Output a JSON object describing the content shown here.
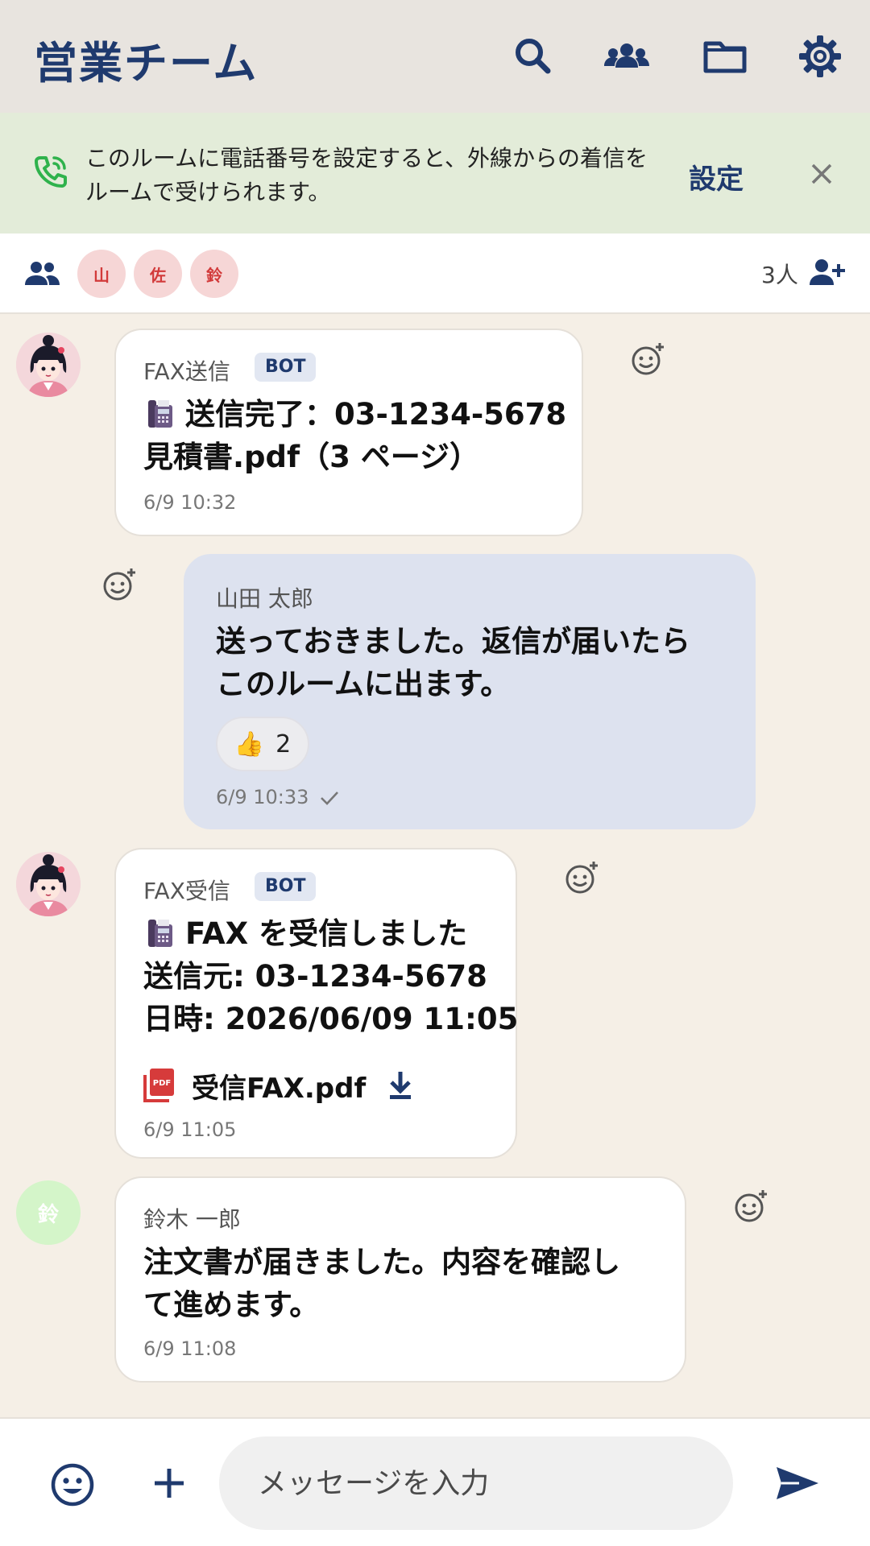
{
  "header": {
    "title": "営業チーム",
    "icons": [
      "search-icon",
      "members-icon",
      "folder-icon",
      "gear-icon"
    ]
  },
  "banner": {
    "text": "このルームに電話番号を設定すると、外線からの着信をルームで受けられます。",
    "setting_label": "設定"
  },
  "members": {
    "avatars": [
      "山",
      "佐",
      "鈴"
    ],
    "count": "3人"
  },
  "messages": [
    {
      "sender": "FAX送信",
      "badge": "BOT",
      "line1": "送信完了：03-1234-5678",
      "line2": "見積書.pdf（3 ページ）",
      "time": "6/9 10:32"
    },
    {
      "sender": "山田 太郎",
      "line1": "送っておきました。返信が届いたら",
      "line2": "このルームに出ます。",
      "reaction_emoji": "👍",
      "reaction_count": "2",
      "time": "6/9 10:33"
    },
    {
      "sender": "FAX受信",
      "badge": "BOT",
      "line1": "FAX を受信しました",
      "line2": "送信元: 03-1234-5678",
      "line3": "日時: 2026/06/09 11:05",
      "file_name": "受信FAX.pdf",
      "time": "6/9 11:05"
    },
    {
      "sender": "鈴木 一郎",
      "avatar_letter": "鈴",
      "line1": "注文書が届きました。内容を確認し",
      "line2": "て進めます。",
      "time": "6/9 11:08"
    }
  ],
  "composer": {
    "placeholder": "メッセージを入力"
  },
  "colors": {
    "brand": "#1f3a6e",
    "banner_bg": "#e3ecd9",
    "chat_bg": "#f5efe6",
    "mine_bubble": "#dde2ef",
    "phone_green": "#2fb24c"
  }
}
